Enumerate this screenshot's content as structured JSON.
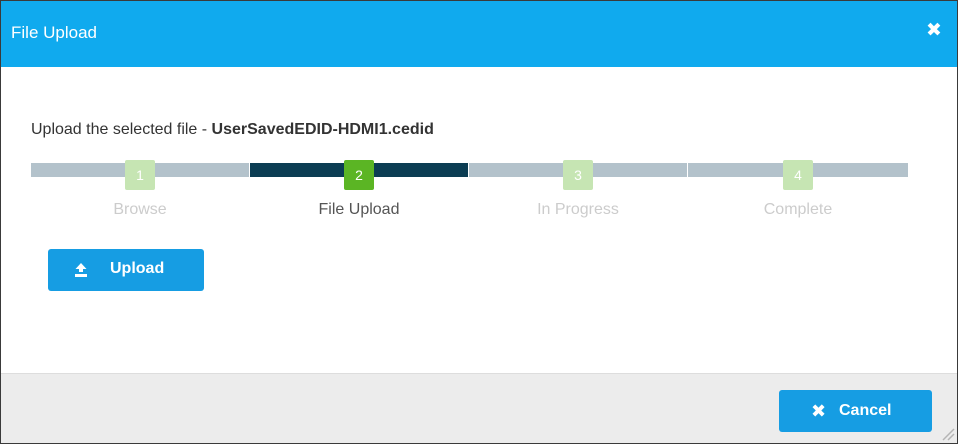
{
  "dialog": {
    "title": "File Upload",
    "close_icon": "close-icon"
  },
  "message": {
    "prefix": "Upload the selected file - ",
    "filename": "UserSavedEDID-HDMI1.cedid"
  },
  "wizard": {
    "current_step": 2,
    "steps": [
      {
        "number": "1",
        "label": "Browse"
      },
      {
        "number": "2",
        "label": "File Upload"
      },
      {
        "number": "3",
        "label": "In Progress"
      },
      {
        "number": "4",
        "label": "Complete"
      }
    ]
  },
  "actions": {
    "upload_label": "Upload",
    "upload_icon": "upload-icon",
    "cancel_label": "Cancel",
    "cancel_icon": "close-icon"
  },
  "colors": {
    "header": "#10aaee",
    "button": "#169de3",
    "step_active_bar": "#0b3d53",
    "step_inactive_bar": "#b3c2cb",
    "step_active_badge": "#5bb524",
    "step_inactive_badge": "#c6e5b3",
    "footer": "#ececec"
  }
}
